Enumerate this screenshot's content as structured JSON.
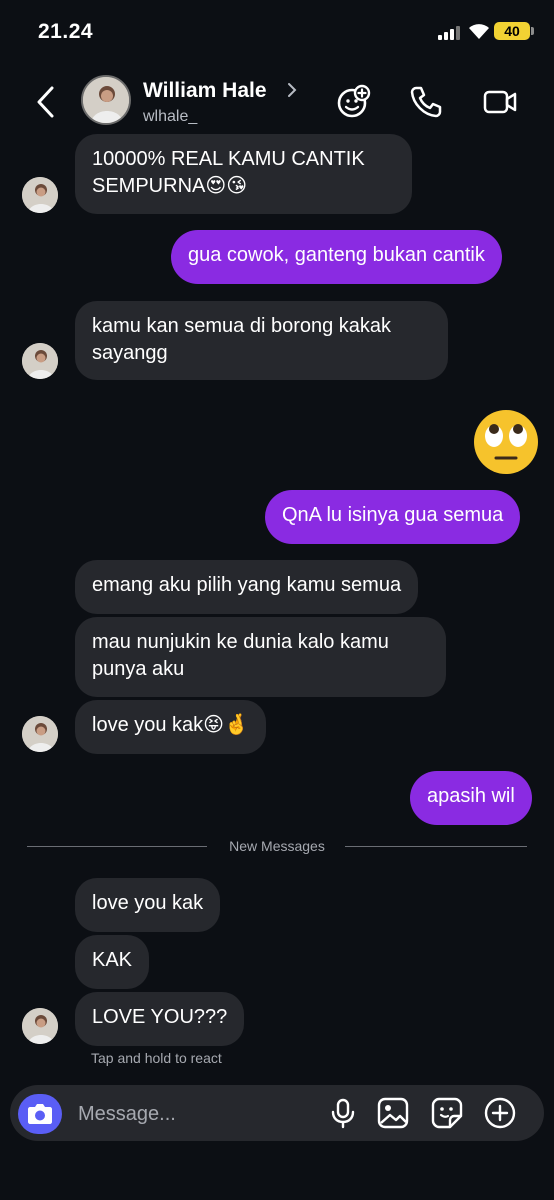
{
  "status_bar": {
    "time": "21.24",
    "battery": "40"
  },
  "header": {
    "name": "William Hale",
    "handle": "wlhale_"
  },
  "messages": [
    {
      "text": "10000% REAL KAMU CANTIK SEMPURNA😍😘"
    },
    {
      "text": "gua cowok, ganteng bukan cantik"
    },
    {
      "text": "kamu kan semua di borong kakak sayangg"
    },
    {
      "text": "🙄"
    },
    {
      "text": "QnA lu isinya gua semua"
    },
    {
      "text": "emang aku pilih yang kamu semua"
    },
    {
      "text": "mau nunjukin ke dunia kalo kamu punya aku"
    },
    {
      "text": "love you kak😝🤞"
    },
    {
      "text": "apasih wil"
    },
    {
      "text": "love you kak"
    },
    {
      "text": "KAK"
    },
    {
      "text": "LOVE YOU???"
    }
  ],
  "divider_label": "New Messages",
  "hint": "Tap and hold to react",
  "composer": {
    "placeholder": "Message..."
  }
}
